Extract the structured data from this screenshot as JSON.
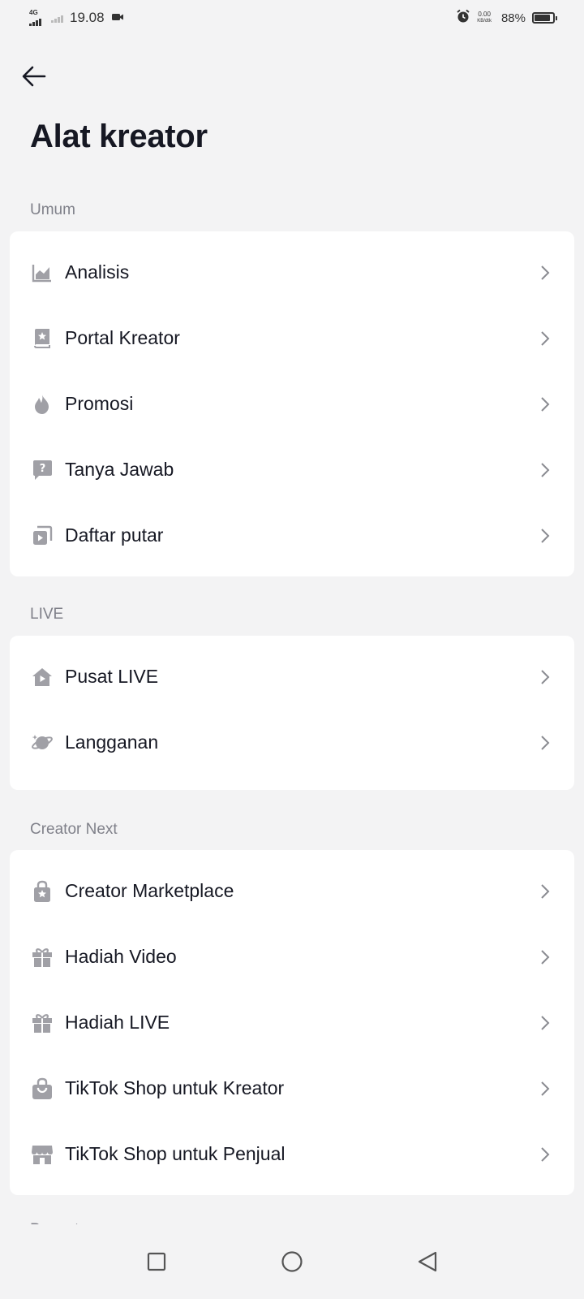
{
  "status_bar": {
    "network": "4G",
    "time": "19.08",
    "net_speed_value": "0.00",
    "net_speed_unit": "KB/dtk",
    "battery_percent": "88%",
    "battery_level": 0.88
  },
  "header": {
    "title": "Alat kreator"
  },
  "sections": {
    "umum": {
      "label": "Umum",
      "items": [
        {
          "label": "Analisis",
          "icon": "chart-icon"
        },
        {
          "label": "Portal Kreator",
          "icon": "book-star-icon"
        },
        {
          "label": "Promosi",
          "icon": "flame-icon"
        },
        {
          "label": "Tanya Jawab",
          "icon": "question-bubble-icon"
        },
        {
          "label": "Daftar putar",
          "icon": "playlist-icon"
        }
      ]
    },
    "live": {
      "label": "LIVE",
      "items": [
        {
          "label": "Pusat LIVE",
          "icon": "live-house-icon"
        },
        {
          "label": "Langganan",
          "icon": "planet-icon"
        }
      ]
    },
    "creator_next": {
      "label": "Creator Next",
      "items": [
        {
          "label": "Creator Marketplace",
          "icon": "bag-star-icon"
        },
        {
          "label": "Hadiah Video",
          "icon": "gift-icon"
        },
        {
          "label": "Hadiah LIVE",
          "icon": "gift-icon"
        },
        {
          "label": "TikTok Shop untuk Kreator",
          "icon": "shopping-bag-icon"
        },
        {
          "label": "TikTok Shop untuk Penjual",
          "icon": "storefront-icon"
        }
      ]
    }
  },
  "next_section_partial_label": "Pengaturan",
  "colors": {
    "background": "#f3f3f4",
    "card": "#ffffff",
    "text": "#161823",
    "muted": "#80818a",
    "icon": "#a0a0a6"
  }
}
